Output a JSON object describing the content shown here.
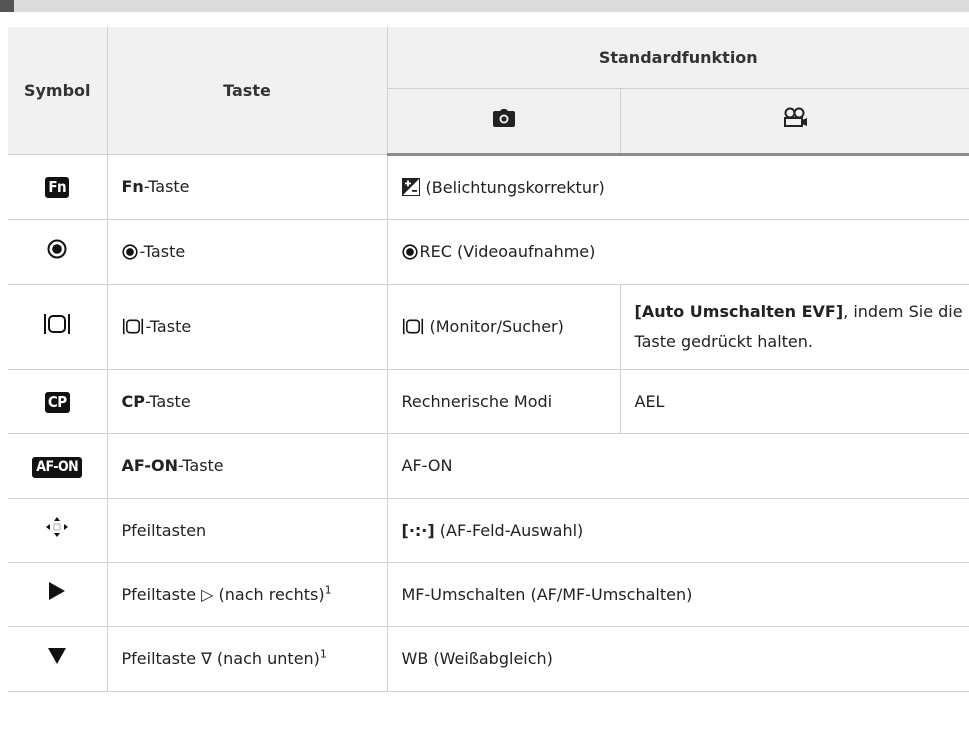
{
  "header": {
    "symbol": "Symbol",
    "taste": "Taste",
    "standard": "Standardfunktion",
    "photo_icon": "camera-icon",
    "movie_icon": "movie-camera-icon"
  },
  "rows": [
    {
      "icon": "Fn",
      "key_bold": "Fn",
      "key_rest": "-Taste",
      "func": "(Belichtungskorrektur)"
    },
    {
      "icon": "record-icon",
      "key_rest": "-Taste",
      "func": "REC (Videoaufnahme)"
    },
    {
      "icon": "monitor-switch-icon",
      "key_rest": "-Taste",
      "func": "(Monitor/Sucher)",
      "func2_bold": "[Auto Umschalten EVF]",
      "func2_rest": ", indem Sie die Taste gedrückt halten."
    },
    {
      "icon": "CP",
      "key_bold": "CP",
      "key_rest": "-Taste",
      "func": "Rechnerische Modi",
      "func2": "AEL"
    },
    {
      "icon": "AF-ON",
      "key_bold": "AF-ON",
      "key_rest": "-Taste",
      "func": "AF-ON"
    },
    {
      "icon": "arrow-pad-icon",
      "key": "Pfeiltasten",
      "func_bold": "[·:·]",
      "func_rest": " (AF-Feld-Auswahl)"
    },
    {
      "icon": "triangle-right-icon",
      "key": "Pfeiltaste ▷ (nach rechts)",
      "sup": "1",
      "func": "MF-Umschalten (AF/MF-Umschalten)"
    },
    {
      "icon": "triangle-down-icon",
      "key": "Pfeiltaste ∇ (nach unten)",
      "sup": "1",
      "func": "WB (Weißabgleich)"
    }
  ]
}
